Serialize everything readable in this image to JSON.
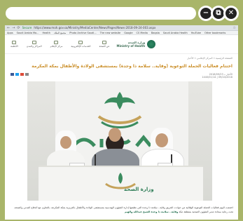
{
  "viewer": {
    "controls": [
      {
        "name": "minimize-icon",
        "glyph": "−"
      },
      {
        "name": "restore-icon",
        "glyph": "⧉"
      },
      {
        "name": "close-icon",
        "glyph": "✕"
      }
    ]
  },
  "browser": {
    "secure_label": "Secure",
    "address": "https://www.moh.gov.sa/Ministry/MediaCenter/News/Pages/News-2018-09-24-003.aspx",
    "bookmarks": [
      "Apps",
      "Saudi Arabia Mo...",
      "Health",
      "مجمع الملك",
      "Photo Archive Saudi...",
      "The new website",
      "Google",
      "CS Media",
      "Baqala",
      "Saudi Arabia Health",
      "YouTube",
      "Other bookmarks"
    ]
  },
  "site": {
    "logo_text_1": "وزارة الصحة",
    "logo_text_2": "Ministry of Health",
    "menu": [
      "عن الصحة",
      "الخدمات الإلكترونية",
      "مركز الإعلام",
      "المراكز والمدن",
      "الأنظمة"
    ],
    "breadcrumb": "الصفحة الرئيسية » المركز الإعلامي » الأخبار",
    "headline": "اختتام فعاليات الحملة التوعوية (وقاية.. سلامة ذا وجدة) بمستشفى الولادة والأطفال بمكة المكرمة",
    "meta_date": "09/24/2018 | 1440/01/14",
    "meta_views": "الأخبار ــ 2018/09/23",
    "photo_table_text": "وزارة الصحة",
    "article": "اختتمت اليوم فعاليات الحملة التوعوية الوقائية من حوادث الحريق وقاية.. سلامة ذا وجدة التي نظمتها إدارة الشؤون الهندسية بمستشفى الولادة والأطفال بالعزيزية بمكة المكرمة، بالتعاون مع الدفاع المدني والصحة، تحت رعاية سعادة مدير الشؤون الصحية بمنطقة مكة",
    "article_bold_1": "وقاية.. سلامة ذا وجدة",
    "article_bold_2": "الشيخ عبدالله والهيم"
  }
}
